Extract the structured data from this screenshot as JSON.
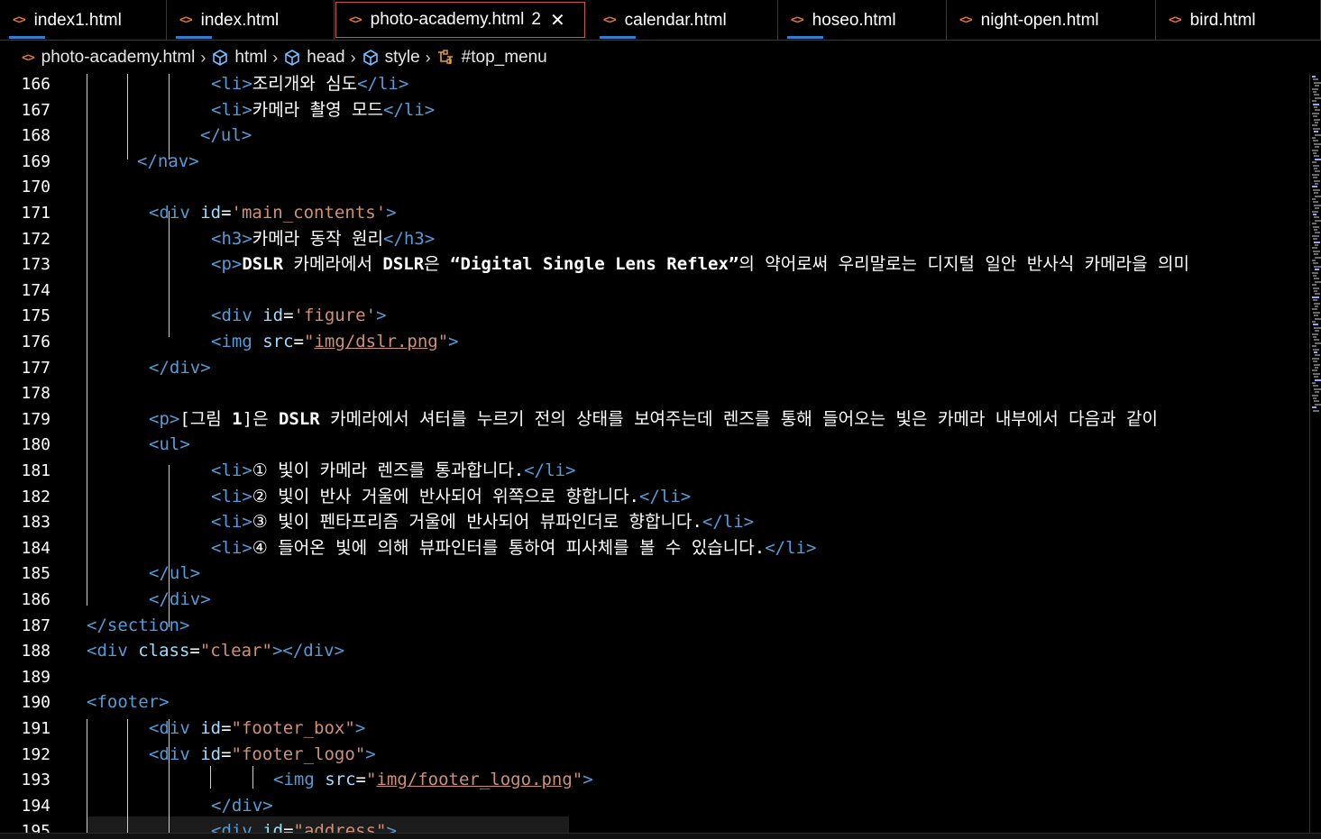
{
  "tabs": [
    {
      "label": "index1.html",
      "icon": "html-file-icon"
    },
    {
      "label": "index.html",
      "icon": "html-file-icon"
    },
    {
      "label": "photo-academy.html",
      "icon": "html-file-icon",
      "dirty": "2",
      "close": "✕",
      "active": true
    },
    {
      "label": "calendar.html",
      "icon": "html-file-icon"
    },
    {
      "label": "hoseo.html",
      "icon": "html-file-icon"
    },
    {
      "label": "night-open.html",
      "icon": "html-file-icon"
    },
    {
      "label": "bird.html",
      "icon": "html-file-icon"
    }
  ],
  "breadcrumb": {
    "file": "photo-academy.html",
    "items": [
      "html",
      "head",
      "style",
      "#top_menu"
    ],
    "file_icon_glyph": "<>"
  },
  "lines": [
    {
      "n": "166",
      "indent": 8,
      "segs": [
        [
          "tg",
          "<li>"
        ],
        [
          "tx",
          "조리개와 심도"
        ],
        [
          "tg",
          "</li>"
        ]
      ]
    },
    {
      "n": "167",
      "indent": 8,
      "segs": [
        [
          "tg",
          "<li>"
        ],
        [
          "tx",
          "카메라 촬영 모드"
        ],
        [
          "tg",
          "</li>"
        ]
      ]
    },
    {
      "n": "168",
      "indent": 7,
      "segs": [
        [
          "tg",
          "</ul>"
        ]
      ]
    },
    {
      "n": "169",
      "indent": 2,
      "segs": [
        [
          "tg",
          "</nav>"
        ]
      ]
    },
    {
      "n": "170",
      "indent": 0,
      "segs": []
    },
    {
      "n": "171",
      "indent": 3,
      "segs": [
        [
          "tg",
          "<div "
        ],
        [
          "at",
          "id"
        ],
        [
          "tx",
          "="
        ],
        [
          "sv",
          "'main_contents'"
        ],
        [
          "tg",
          ">"
        ]
      ]
    },
    {
      "n": "172",
      "indent": 8,
      "segs": [
        [
          "tg",
          "<h3>"
        ],
        [
          "tx",
          "카메라 동작 원리"
        ],
        [
          "tg",
          "</h3>"
        ]
      ]
    },
    {
      "n": "173",
      "indent": 8,
      "segs": [
        [
          "tg",
          "<p>"
        ],
        [
          "b",
          "DSLR"
        ],
        [
          "tx",
          " 카메라에서 "
        ],
        [
          "b",
          "DSLR"
        ],
        [
          "tx",
          "은 "
        ],
        [
          "b",
          "“Digital Single Lens Reflex”"
        ],
        [
          "tx",
          "의 약어로써 우리말로는 디지털 일안 반사식 카메라을 의미"
        ]
      ]
    },
    {
      "n": "174",
      "indent": 0,
      "segs": []
    },
    {
      "n": "175",
      "indent": 8,
      "segs": [
        [
          "tg",
          "<div "
        ],
        [
          "at",
          "id"
        ],
        [
          "tx",
          "="
        ],
        [
          "sv",
          "'figure'"
        ],
        [
          "tg",
          ">"
        ]
      ]
    },
    {
      "n": "176",
      "indent": 8,
      "segs": [
        [
          "tg",
          "<img "
        ],
        [
          "at",
          "src"
        ],
        [
          "tx",
          "="
        ],
        [
          "sv",
          "\""
        ],
        [
          "svu",
          "img/dslr.png"
        ],
        [
          "sv",
          "\""
        ],
        [
          "tg",
          ">"
        ]
      ]
    },
    {
      "n": "177",
      "indent": 3,
      "segs": [
        [
          "tg",
          "</div>"
        ]
      ]
    },
    {
      "n": "178",
      "indent": 0,
      "segs": []
    },
    {
      "n": "179",
      "indent": 3,
      "segs": [
        [
          "tg",
          "<p>"
        ],
        [
          "tx",
          "[그림 "
        ],
        [
          "b",
          "1"
        ],
        [
          "tx",
          "]은 "
        ],
        [
          "b",
          "DSLR"
        ],
        [
          "tx",
          " 카메라에서 셔터를 누르기 전의 상태를 보여주는데 렌즈를 통해 들어오는 빛은 카메라 내부에서 다음과 같이"
        ]
      ]
    },
    {
      "n": "180",
      "indent": 3,
      "segs": [
        [
          "tg",
          "<ul>"
        ]
      ]
    },
    {
      "n": "181",
      "indent": 8,
      "segs": [
        [
          "tg",
          "<li>"
        ],
        [
          "tx",
          "① 빛이 카메라 렌즈를 통과합니다."
        ],
        [
          "tg",
          "</li>"
        ]
      ]
    },
    {
      "n": "182",
      "indent": 8,
      "segs": [
        [
          "tg",
          "<li>"
        ],
        [
          "tx",
          "② 빛이 반사 거울에 반사되어 위쪽으로 향합니다."
        ],
        [
          "tg",
          "</li>"
        ]
      ]
    },
    {
      "n": "183",
      "indent": 8,
      "segs": [
        [
          "tg",
          "<li>"
        ],
        [
          "tx",
          "③ 빛이 펜타프리즘 거울에 반사되어 뷰파인더로 향합니다."
        ],
        [
          "tg",
          "</li>"
        ]
      ]
    },
    {
      "n": "184",
      "indent": 8,
      "segs": [
        [
          "tg",
          "<li>"
        ],
        [
          "tx",
          "④ 들어온 빛에 의해 뷰파인터를 통하여 피사체를 볼 수 있습니다."
        ],
        [
          "tg",
          "</li>"
        ]
      ]
    },
    {
      "n": "185",
      "indent": 3,
      "segs": [
        [
          "tg",
          "</ul>"
        ]
      ]
    },
    {
      "n": "186",
      "indent": 3,
      "segs": [
        [
          "tg",
          "</div>"
        ]
      ]
    },
    {
      "n": "187",
      "indent": 0,
      "segs": [
        [
          "tg",
          "</section>"
        ]
      ]
    },
    {
      "n": "188",
      "indent": 0,
      "segs": [
        [
          "tg",
          "<div "
        ],
        [
          "at",
          "class"
        ],
        [
          "tx",
          "="
        ],
        [
          "sv",
          "\"clear\""
        ],
        [
          "tg",
          "></div>"
        ]
      ]
    },
    {
      "n": "189",
      "indent": 0,
      "segs": []
    },
    {
      "n": "190",
      "indent": 0,
      "segs": [
        [
          "tg",
          "<footer>"
        ]
      ]
    },
    {
      "n": "191",
      "indent": 3,
      "segs": [
        [
          "tg",
          "<div "
        ],
        [
          "at",
          "id"
        ],
        [
          "tx",
          "="
        ],
        [
          "sv",
          "\"footer_box\""
        ],
        [
          "tg",
          ">"
        ]
      ]
    },
    {
      "n": "192",
      "indent": 3,
      "segs": [
        [
          "tg",
          "<div "
        ],
        [
          "at",
          "id"
        ],
        [
          "tx",
          "="
        ],
        [
          "sv",
          "\"footer_logo\""
        ],
        [
          "tg",
          ">"
        ]
      ]
    },
    {
      "n": "193",
      "indent": 11,
      "segs": [
        [
          "tg",
          "<img "
        ],
        [
          "at",
          "src"
        ],
        [
          "tx",
          "="
        ],
        [
          "sv",
          "\""
        ],
        [
          "svu",
          "img/footer_logo.png"
        ],
        [
          "sv",
          "\""
        ],
        [
          "tg",
          ">"
        ]
      ]
    },
    {
      "n": "194",
      "indent": 8,
      "segs": [
        [
          "tg",
          "</div>"
        ]
      ]
    },
    {
      "n": "195",
      "indent": 8,
      "segs": [
        [
          "tg",
          "<div "
        ],
        [
          "at",
          "id"
        ],
        [
          "tx",
          "="
        ],
        [
          "sv",
          "\"address\""
        ],
        [
          "tg",
          ">"
        ]
      ]
    }
  ],
  "colors": {
    "tag": "#569cd6",
    "attr": "#9cdcfe",
    "string": "#ce9178",
    "text": "#ffffff",
    "background": "#000000",
    "file_icon": "#e07a3a",
    "active_tab_border": "#c75a3a"
  }
}
